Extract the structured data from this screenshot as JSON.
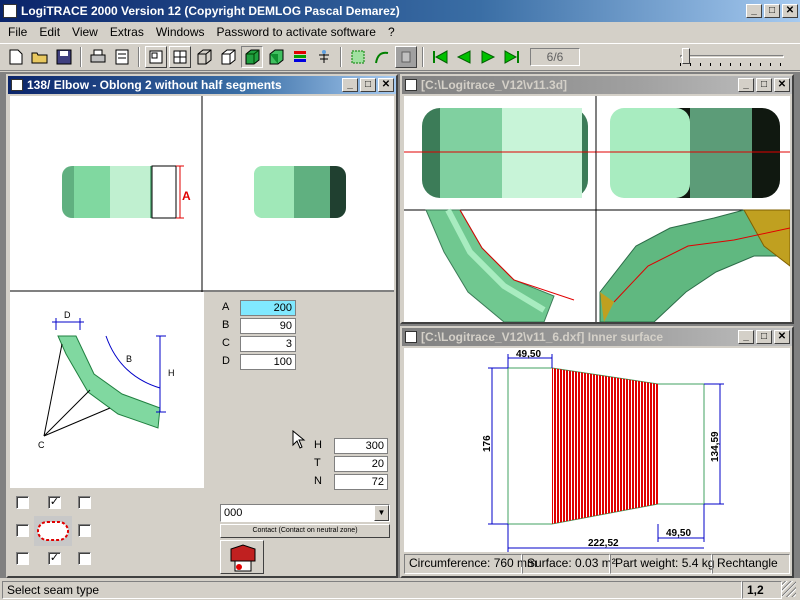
{
  "app": {
    "title": "LogiTRACE 2000  Version 12  (Copyright DEMLOG Pascal Demarez)"
  },
  "menu": {
    "items": [
      "File",
      "Edit",
      "View",
      "Extras",
      "Windows",
      "Password to activate software",
      "?"
    ]
  },
  "toolbar": {
    "page_counter": "6/6"
  },
  "window_elbow": {
    "title": "138/ Elbow - Oblong 2 without half segments",
    "dim_label_a": "A",
    "sketch_labels": {
      "d": "D",
      "b": "B",
      "h": "H",
      "c": "C"
    },
    "params": [
      {
        "label": "A",
        "value": "200"
      },
      {
        "label": "B",
        "value": "90"
      },
      {
        "label": "C",
        "value": "3"
      },
      {
        "label": "D",
        "value": "100"
      }
    ],
    "params2": [
      {
        "label": "H",
        "value": "300"
      },
      {
        "label": "T",
        "value": "20"
      },
      {
        "label": "N",
        "value": "72"
      }
    ],
    "checkboxes": [
      {
        "checked": false
      },
      {
        "checked": true
      },
      {
        "checked": false
      },
      {
        "checked": false
      },
      {
        "checked": false
      },
      {
        "checked": false
      },
      {
        "checked": true
      },
      {
        "checked": false
      }
    ],
    "combo_value": "000",
    "contact_button": "Contact (Contact on neutral zone)"
  },
  "window_3d": {
    "title": "[C:\\Logitrace_V12\\v11.3d]"
  },
  "window_dxf": {
    "title": "[C:\\Logitrace_V12\\v11_6.dxf]  Inner surface",
    "dims": {
      "top": "49,50",
      "left": "176",
      "right": "134,59",
      "bottom_small": "49,50",
      "bottom": "222,52"
    },
    "status": [
      "Circumference: 760 mm",
      "Surface: 0.03 m²",
      "Part weight: 5.4 kg",
      "Rechtangle"
    ]
  },
  "statusbar": {
    "message": "Select seam type",
    "position": "1,2"
  },
  "colors": {
    "title_active": "#0a246a",
    "part_green": "#7fd4a0",
    "cut_red": "#e00000",
    "dim_blue": "#0000c8",
    "field_highlight": "#80e8ff"
  }
}
